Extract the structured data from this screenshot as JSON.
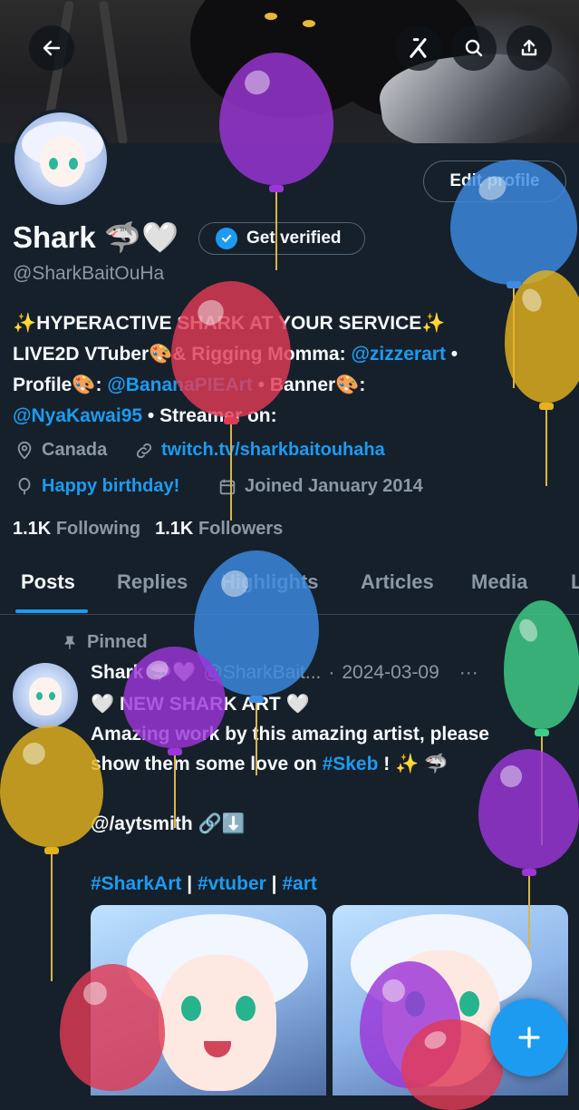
{
  "header": {
    "back_icon": "arrow-left-icon",
    "grok_icon": "grok-icon",
    "search_icon": "search-icon",
    "share_icon": "share-icon"
  },
  "profile": {
    "edit_label": "Edit profile",
    "display_name": "Shark 🦈🤍",
    "verified_label": "Get verified",
    "handle": "@SharkBaitOuHa",
    "bio": {
      "line1": "✨HYPERACTIVE SHARK AT YOUR SERVICE✨",
      "line2_text": "LIVE2D VTuber🎨& Rigging Momma: ",
      "line2_link": "@zizzerart",
      "line2_end": " •",
      "line3_text": "Profile🎨: ",
      "line3_link": "@BananaPIEArt",
      "line3_mid": " • Banner🎨:",
      "line4_link": "@NyaKawai95",
      "line4_end": " • Streamer on:"
    },
    "location": "Canada",
    "website": "twitch.tv/sharkbaitouhaha",
    "birthday": "Happy birthday!",
    "joined": "Joined January 2014",
    "following_count": "1.1K",
    "following_label": "Following",
    "followers_count": "1.1K",
    "followers_label": "Followers"
  },
  "tabs": [
    "Posts",
    "Replies",
    "Highlights",
    "Articles",
    "Media",
    "L"
  ],
  "pinned_post": {
    "pinned_label": "Pinned",
    "author": "Shark 🦈🤍",
    "handle": "@SharkBait...",
    "dot": "·",
    "date": "2024-03-09",
    "line1": "🤍 NEW SHARK ART 🤍",
    "line2": "Amazing work by this amazing artist, please",
    "line3_text": "show them some love on ",
    "line3_link": "#Skeb",
    "line3_end": " ! ✨ 🦈",
    "line4": "@/aytsmith 🔗⬇️",
    "tags": [
      "#SharkArt",
      "#vtuber",
      "#art"
    ],
    "tag_sep": " | "
  },
  "fab_icon": "compose-plus-icon",
  "colors": {
    "background": "#15202b",
    "accent": "#1d9bf0",
    "muted": "#8b98a5"
  }
}
